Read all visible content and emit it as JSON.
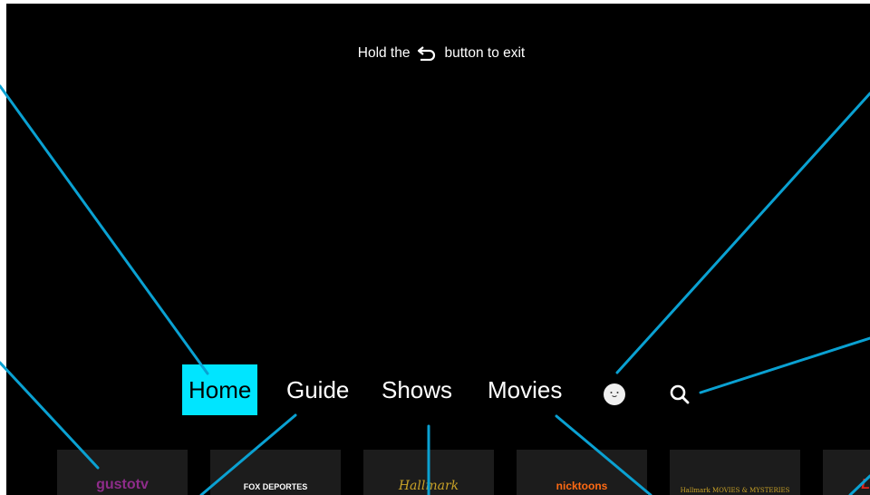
{
  "exit_hint": {
    "prefix": "Hold the",
    "suffix": "button to exit",
    "icon": "back-arrow-icon"
  },
  "nav": {
    "items": [
      {
        "label": "Home",
        "active": true
      },
      {
        "label": "Guide",
        "active": false
      },
      {
        "label": "Shows",
        "active": false
      },
      {
        "label": "Movies",
        "active": false
      }
    ],
    "profile_icon": "profile-face-icon",
    "search_icon": "search-icon"
  },
  "tiles": [
    {
      "name": "gusto tv",
      "label": "gustotv",
      "color": "#8e2c8a"
    },
    {
      "name": "FOX Deportes",
      "label": "FOX DEPORTES",
      "color": "#ffffff"
    },
    {
      "name": "Hallmark",
      "label": "Hallmark",
      "color": "#c9a227"
    },
    {
      "name": "Nicktoons",
      "label": "nicktoons",
      "color": "#ff6a13"
    },
    {
      "name": "Hallmark Movies & Mysteries",
      "label": "Hallmark MOVIES & MYSTERIES",
      "color": "#c9a227"
    },
    {
      "name": "Lifetime",
      "label": "L",
      "color": "#e1251b"
    }
  ],
  "colors": {
    "background": "#000000",
    "focus": "#00e5ff",
    "annotation_lines": "#0aa1d2"
  }
}
